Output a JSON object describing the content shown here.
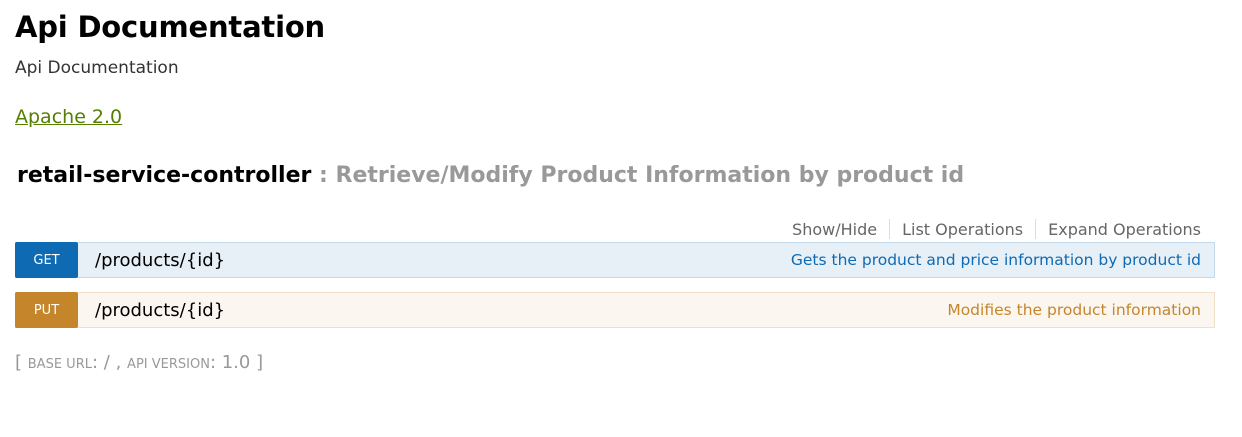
{
  "info": {
    "title": "Api Documentation",
    "description": "Api Documentation",
    "license_label": "Apache 2.0"
  },
  "resource": {
    "name": "retail-service-controller",
    "separator": ":",
    "description": "Retrieve/Modify Product Information by product id",
    "options": {
      "show_hide": "Show/Hide",
      "list_operations": "List Operations",
      "expand_operations": "Expand Operations"
    },
    "operations": [
      {
        "method": "GET",
        "path": "/products/{id}",
        "summary": "Gets the product and price information by product id",
        "color": "#0f6ab4"
      },
      {
        "method": "PUT",
        "path": "/products/{id}",
        "summary": "Modifies the product information",
        "color": "#c5862b"
      }
    ]
  },
  "footer": {
    "open_bracket": "[",
    "base_url_label": "base url",
    "base_url_value": "/",
    "comma": ",",
    "api_version_label": "api version",
    "api_version_value": "1.0",
    "close_bracket": "]"
  },
  "colors": {
    "link": "#547f00",
    "muted": "#999999"
  }
}
